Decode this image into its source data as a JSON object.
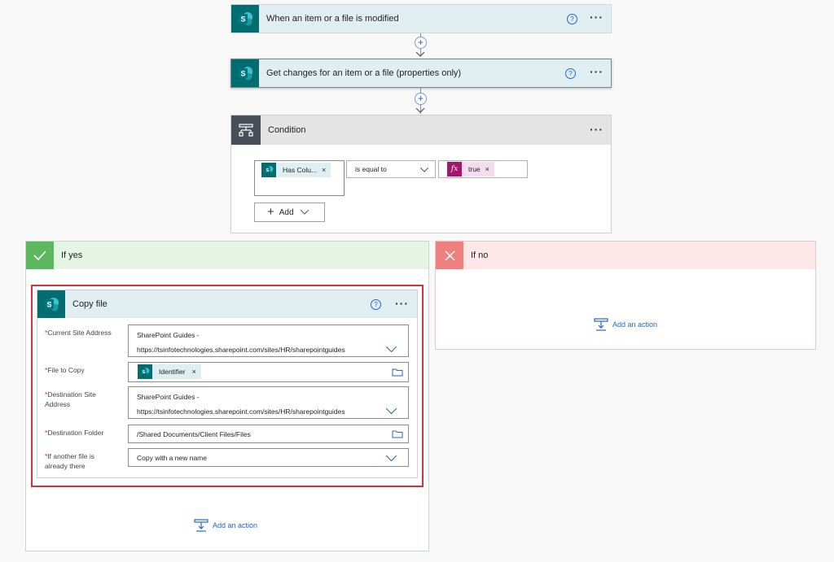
{
  "trigger": {
    "title": "When an item or a file is modified",
    "icon": "sharepoint-icon"
  },
  "get_changes": {
    "title": "Get changes for an item or a file (properties only)",
    "icon": "sharepoint-icon"
  },
  "condition": {
    "title": "Condition",
    "icon": "condition-icon",
    "left_token": "Has Colu...",
    "operator": "is equal to",
    "right_token": "true",
    "add_label": "Add"
  },
  "if_yes": {
    "title": "If yes",
    "add_action": "Add an action"
  },
  "if_no": {
    "title": "If no",
    "add_action": "Add an action"
  },
  "copy_file": {
    "title": "Copy file",
    "fields": {
      "current_site": {
        "label": "Current Site Address",
        "line1": "SharePoint Guides -",
        "line2": "https://tsinfotechnologies.sharepoint.com/sites/HR/sharepointguides"
      },
      "file_to_copy": {
        "label": "File to Copy",
        "token": "Identifier"
      },
      "dest_site": {
        "label1": "Destination Site",
        "label2": "Address",
        "line1": "SharePoint Guides -",
        "line2": "https://tsinfotechnologies.sharepoint.com/sites/HR/sharepointguides"
      },
      "dest_folder": {
        "label": "Destination Folder",
        "value": "/Shared Documents/Client Files/Files"
      },
      "if_exists": {
        "label1": "If another file is",
        "label2": "already there",
        "value": "Copy with a new name"
      }
    }
  },
  "colors": {
    "sharepoint": "#036c70",
    "header_bg": "#e1eef1",
    "condition_dark": "#484f58",
    "yes_green": "#5cb85c",
    "no_red": "#f08080",
    "highlight": "#d13438",
    "link": "#2266cc"
  }
}
